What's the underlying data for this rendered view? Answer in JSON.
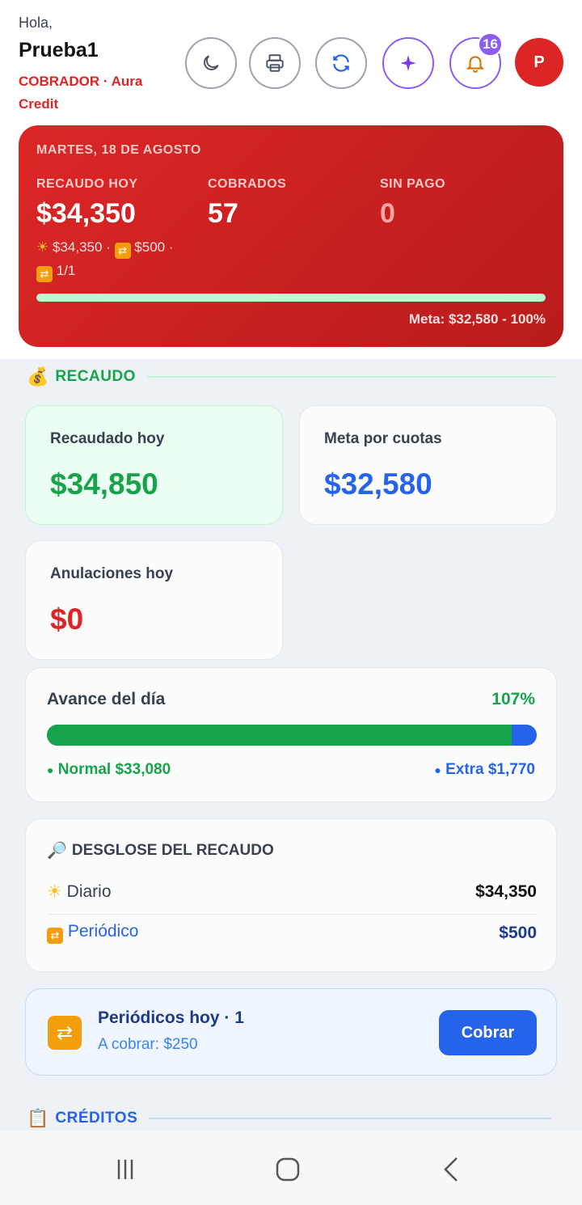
{
  "header": {
    "greeting": "Hola,",
    "user_name": "Prueba1",
    "role": "COBRADOR · Aura Credit",
    "notification_count": "16",
    "avatar_initial": "P"
  },
  "summary": {
    "date": "MARTES, 18 DE AGOSTO",
    "stats": [
      {
        "label": "RECAUDO HOY",
        "value": "$34,350"
      },
      {
        "label": "COBRADOS",
        "value": "57"
      },
      {
        "label": "SIN PAGO",
        "value": "0"
      }
    ],
    "breakdown_daily": "$34,350",
    "breakdown_periodic": "$500",
    "breakdown_count": "1/1",
    "goal_progress": 1.0,
    "goal_text": "Meta: $32,580 - 100%"
  },
  "recaudo_section": {
    "title": "RECAUDO",
    "cards": [
      {
        "label": "Recaudado hoy",
        "value": "$34,850"
      },
      {
        "label": "Meta por cuotas",
        "value": "$32,580"
      },
      {
        "label": "Anulaciones hoy",
        "value": "$0"
      }
    ]
  },
  "progress": {
    "title": "Avance del día",
    "percent": "107%",
    "normal_fraction": 0.949,
    "normal_label": "Normal $33,080",
    "extra_label": "Extra $1,770"
  },
  "desglose": {
    "title": "DESGLOSE DEL RECAUDO",
    "rows": [
      {
        "label": "Diario",
        "value": "$34,350"
      },
      {
        "label": "Periódico",
        "value": "$500"
      }
    ]
  },
  "periodicos": {
    "title": "Periódicos hoy · 1",
    "subtitle": "A cobrar: $250",
    "button_label": "Cobrar"
  },
  "creditos_section": {
    "title": "CRÉDITOS"
  },
  "colors": {
    "red": "#dc2626",
    "green": "#16a34a",
    "blue": "#2563eb",
    "purple": "#8b5cf6"
  }
}
